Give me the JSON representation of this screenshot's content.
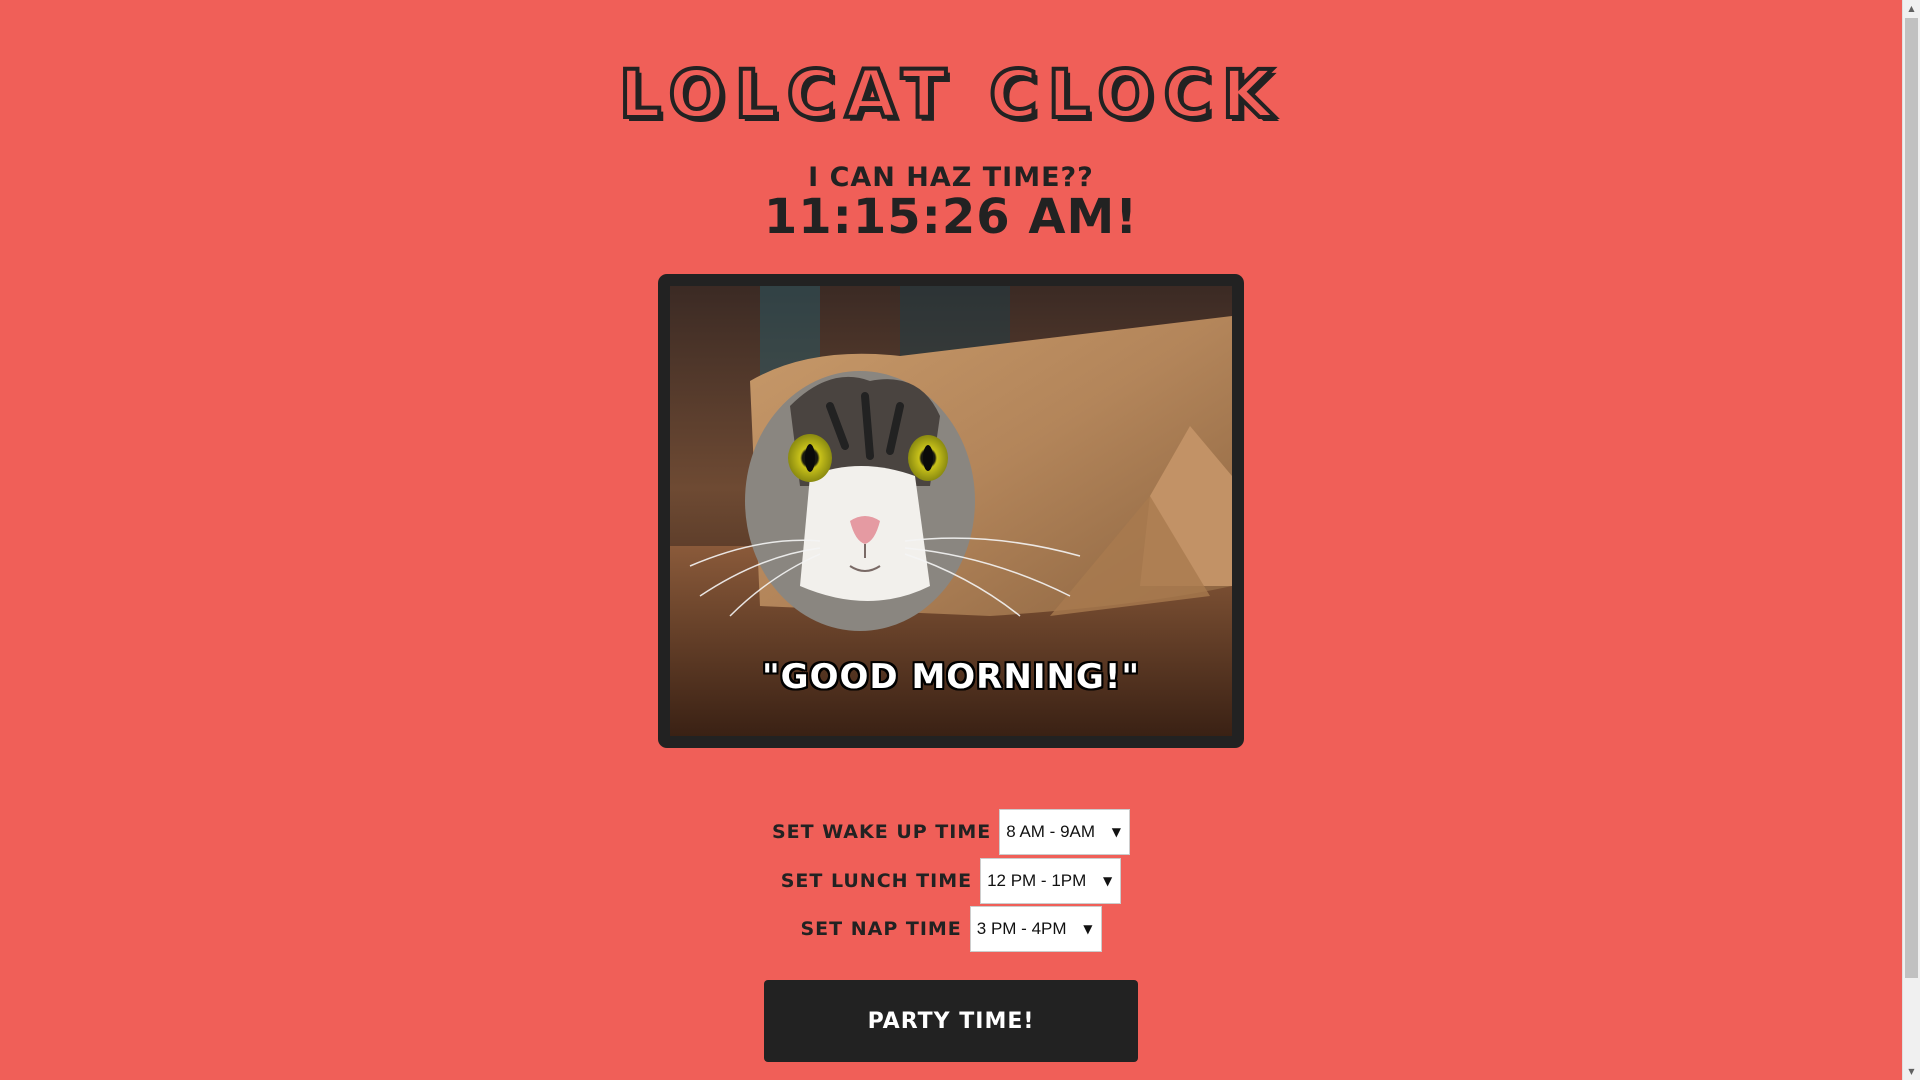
{
  "header": {
    "title": "Lolcat Clock",
    "subtitle": "I can haz time??",
    "clock": "11:15:26 AM!"
  },
  "image": {
    "caption": "\"GOOD MORNING!\"",
    "description_icon": "cat-in-paper-roll"
  },
  "settings": {
    "wake_up": {
      "label": "Set Wake Up Time",
      "value": "8 AM - 9AM"
    },
    "lunch": {
      "label": "Set Lunch Time",
      "value": "12 PM - 1PM"
    },
    "nap": {
      "label": "Set Nap Time",
      "value": "3 PM - 4PM"
    }
  },
  "party_button": {
    "label": "Party Time!"
  },
  "colors": {
    "background": "#f05f58",
    "dark": "#222222",
    "white": "#ffffff"
  }
}
